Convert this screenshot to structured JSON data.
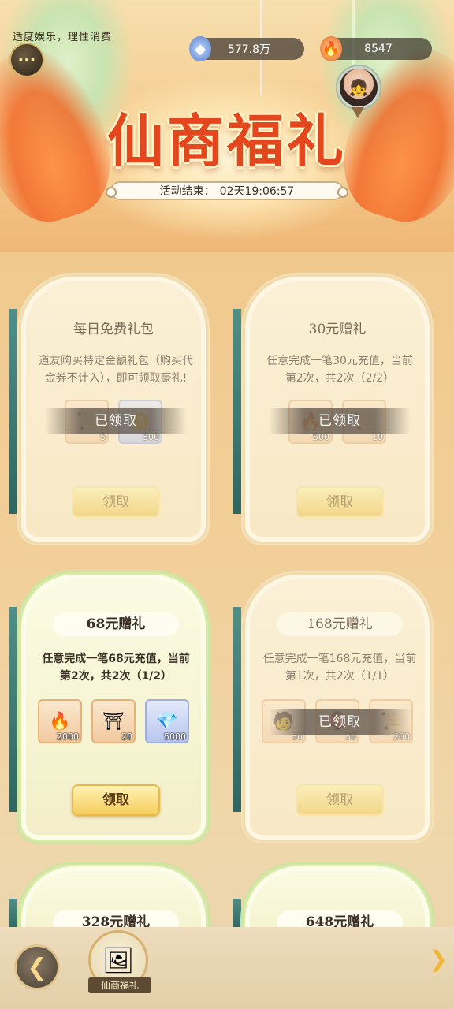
{
  "header": {
    "notice": "适度娱乐，理性消费",
    "currencies": [
      {
        "icon": "spirit-stone-icon",
        "value": "577.8万"
      },
      {
        "icon": "flame-gem-icon",
        "value": "8547"
      }
    ],
    "title": "仙商福礼",
    "timer_label": "活动结束：",
    "timer_value": "02天19:06:57"
  },
  "cards": [
    {
      "title": "每日免费礼包",
      "desc": "道友购买特定金额礼包（购买代金券不计入），即可领取豪礼!",
      "items": [
        {
          "icon": "scroll",
          "qty": "5"
        },
        {
          "icon": "token",
          "qty": "300"
        }
      ],
      "status": "已领取",
      "button": "领取"
    },
    {
      "title": "30元赠礼",
      "desc": "任意完成一笔30元充值，当前第2次，共2次（2/2）",
      "items": [
        {
          "icon": "flame",
          "qty": "500"
        },
        {
          "icon": "scroll",
          "qty": "10"
        }
      ],
      "status": "已领取",
      "button": "领取"
    },
    {
      "title": "68元赠礼",
      "desc": "任意完成一笔68元充值，当前第2次，共2次（1/2）",
      "items": [
        {
          "icon": "flame",
          "qty": "2000"
        },
        {
          "icon": "pavilion",
          "qty": "20"
        },
        {
          "icon": "crystal",
          "qty": "5000"
        }
      ],
      "status": "",
      "button": "领取"
    },
    {
      "title": "168元赠礼",
      "desc": "任意完成一笔168元充值，当前第1次，共2次（1/1）",
      "items": [
        {
          "icon": "figure",
          "qty": "50"
        },
        {
          "icon": "lantern",
          "qty": "30"
        },
        {
          "icon": "scroll",
          "qty": "200"
        }
      ],
      "status": "已领取",
      "button": "领取"
    },
    {
      "title": "328元赠礼"
    },
    {
      "title": "648元赠礼"
    }
  ],
  "bottom_nav": {
    "back": "back-arrow-icon",
    "tab_label": "仙商福礼",
    "next": "chevron-right-icon"
  }
}
